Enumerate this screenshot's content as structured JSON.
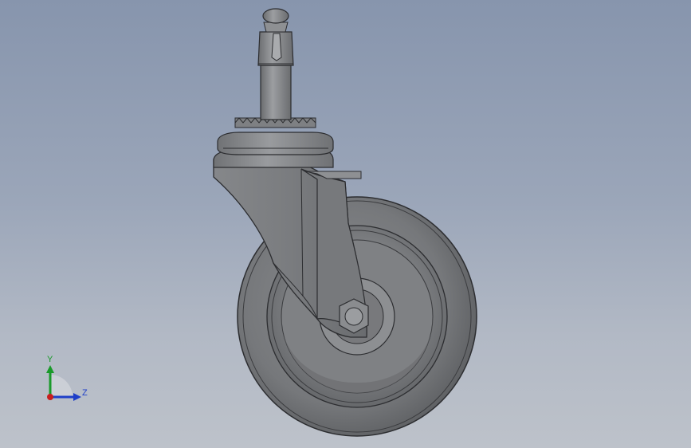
{
  "model": {
    "name": "caster-wheel-model",
    "colors": {
      "body": "#7d7f82",
      "body_dark": "#5e6063",
      "body_light": "#a4a6a9",
      "edge": "#2c2d30"
    }
  },
  "triad": {
    "y_label": "Y",
    "z_label": "Z",
    "colors": {
      "y": "#1a9a2a",
      "z": "#1f3fc8",
      "x": "#c81e1e"
    }
  }
}
